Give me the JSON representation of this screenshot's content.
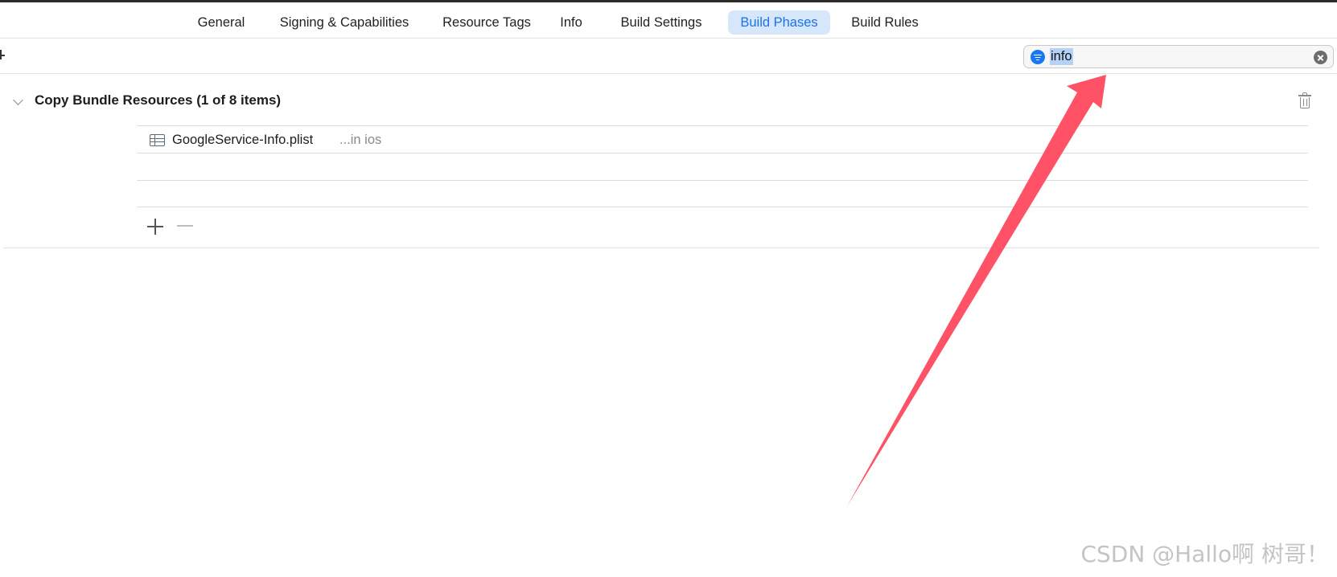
{
  "tabs": [
    {
      "label": "General",
      "active": false
    },
    {
      "label": "Signing & Capabilities",
      "active": false
    },
    {
      "label": "Resource Tags",
      "active": false
    },
    {
      "label": "Info",
      "active": false
    },
    {
      "label": "Build Settings",
      "active": false
    },
    {
      "label": "Build Phases",
      "active": true
    },
    {
      "label": "Build Rules",
      "active": false
    }
  ],
  "filter": {
    "value": "info",
    "icon": "filter-icon",
    "clear_icon": "clear-icon"
  },
  "phase": {
    "title": "Copy Bundle Resources (1 of 8 items)",
    "expanded": true,
    "files": [
      {
        "name": "GoogleService-Info.plist",
        "location": "...in ios",
        "icon": "plist-file-icon"
      }
    ]
  },
  "annotation": {
    "color": "#ff5267"
  },
  "watermark": "CSDN @Hallo啊 树哥！",
  "colors": {
    "accent": "#1a73e8",
    "active_tab_bg": "#d6e6fb",
    "selection": "#b3d2f5"
  }
}
